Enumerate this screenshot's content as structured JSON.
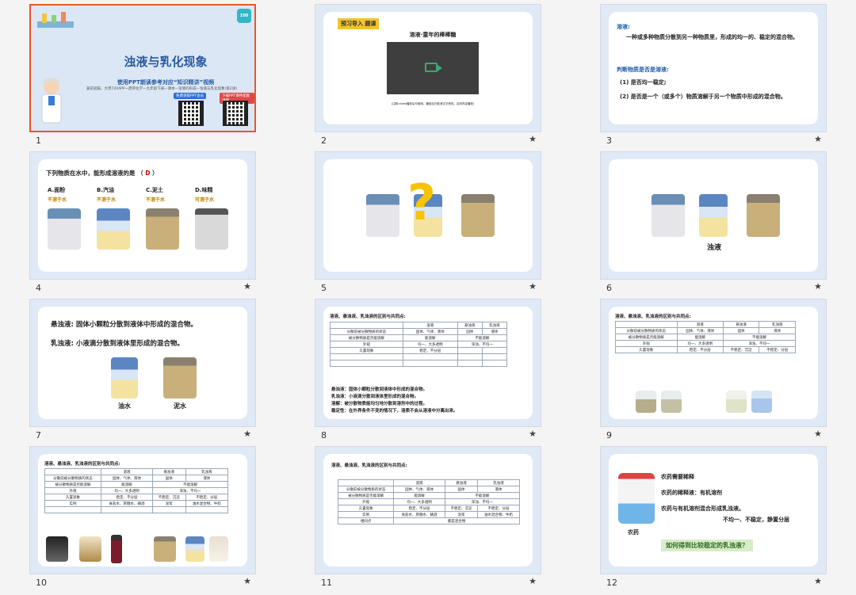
{
  "slides": [
    {
      "num": "1",
      "title": "浊液与乳化现象",
      "subtitle": "使用PPT朗读参考对应“知识精讲”视频",
      "line": "兼前短篇，大用720APP一鼎带化学—九年级下册—课本—溶液的形成—浊液与乳化现象(第2讲)",
      "btn_a": "免费领取PPT会员",
      "btn_b": "下载PPT课件配套讲解",
      "logo": "100"
    },
    {
      "num": "2",
      "tag": "预习导入 题课",
      "video_title": "溶液·童年的棒棒糖",
      "caption": "(注释:video播放后可使用，播放后已取消交叉修改。否则内容播放)"
    },
    {
      "num": "3",
      "h1": "溶液:",
      "def": "一种或多种物质分散到另一种物质里，形成的均一的、稳定的混合物。",
      "h2": "判断物质是否是溶液:",
      "p1": "(1)  是否均一稳定;",
      "p2": "(2)  是否是一个（或多个）物质溶解于另一个物质中形成的混合物。"
    },
    {
      "num": "4",
      "question": "下列物质在水中，能形成溶液的是 （",
      "answer": "D",
      "close": "）",
      "options": [
        {
          "label": "A.面粉",
          "note": "不溶于水"
        },
        {
          "label": "B.汽油",
          "note": "不溶于水"
        },
        {
          "label": "C.泥土",
          "note": "不溶于水"
        },
        {
          "label": "D.味精",
          "note": "可溶于水"
        }
      ]
    },
    {
      "num": "5",
      "mark": "?"
    },
    {
      "num": "6",
      "label": "浊液"
    },
    {
      "num": "7",
      "l1": "悬浊液: 固体小颗粒分散到液体中形成的混合物。",
      "l2": "乳浊液: 小液滴分散到液体里形成的混合物。",
      "c1": "油水",
      "c2": "泥水"
    },
    {
      "num": "8",
      "title": "溶液、悬浊液、乳浊液的区别与共同点:",
      "header": [
        "",
        "溶液",
        "悬浊液",
        "乳浊液"
      ],
      "rows": [
        [
          "分散前被分散物质的状态",
          "固体、气体、液体",
          "固体",
          "液体"
        ],
        [
          "被分散物质是否能溶解",
          "能溶解",
          "不能溶解",
          ""
        ],
        [
          "外观",
          "均一、大多透明",
          "浑浊、不均一",
          ""
        ],
        [
          "久置现象",
          "稳定、不分层",
          "",
          ""
        ],
        [
          "",
          "",
          "",
          ""
        ],
        [
          "",
          "",
          "",
          ""
        ]
      ],
      "notes": [
        "悬浊液：固体小颗粒分散到液体中形成的混合物。",
        "乳浊液：小液滴分散到液体里形成的混合物。",
        "溶解：被分散物质能均匀地分散到溶剂中的过程。",
        "稳定性：在外界条件不变的情况下，溶质不会从溶液中分离出来。"
      ]
    },
    {
      "num": "9",
      "title": "溶液、悬浊液、乳浊液的区别与共同点:",
      "header": [
        "",
        "溶液",
        "悬浊液",
        "乳浊液"
      ],
      "rows": [
        [
          "分散前被分散物质的状态",
          "固体、气体、液体",
          "固体",
          "液体"
        ],
        [
          "被分散物质是否能溶解",
          "能溶解",
          "不能溶解",
          ""
        ],
        [
          "外观",
          "均一、大多透明",
          "浑浊、不均一",
          ""
        ],
        [
          "久置现象",
          "稳定、不分层",
          "不稳定、沉淀",
          "不稳定、分层"
        ]
      ]
    },
    {
      "num": "10",
      "title": "溶液、悬浊液、乳浊液的区别与共同点:",
      "header": [
        "",
        "溶液",
        "悬浊液",
        "乳浊液"
      ],
      "rows": [
        [
          "分散前被分散物质的状态",
          "固体、气体、液体",
          "固体",
          "液体"
        ],
        [
          "被分散物质是否能溶解",
          "能溶解",
          "不能溶解",
          ""
        ],
        [
          "外观",
          "均一、大多透明",
          "浑浊、不均一",
          ""
        ],
        [
          "久置现象",
          "稳定、不分层",
          "不稳定、沉淀",
          "不稳定、分层"
        ],
        [
          "实例",
          "食盐水、蔗糖水、碘酒",
          "泥浆",
          "油水混合物、牛奶"
        ],
        [
          "",
          "",
          "",
          ""
        ]
      ]
    },
    {
      "num": "11",
      "title": "溶液、悬浊液、乳浊液的区别与共同点:",
      "header": [
        "",
        "溶液",
        "悬浊液",
        "乳浊液"
      ],
      "rows": [
        [
          "分散前被分散物质的状态",
          "固体、气体、液体",
          "固体",
          "液体"
        ],
        [
          "被分散物质是否能溶解",
          "能溶解",
          "不能溶解",
          ""
        ],
        [
          "外观",
          "均一、大多透明",
          "浑浊、不均一",
          ""
        ],
        [
          "久置现象",
          "稳定、不分层",
          "不稳定、沉淀",
          "不稳定、分层"
        ],
        [
          "实例",
          "食盐水、蔗糖水、碘酒",
          "泥浆",
          "油水混合物、牛奶"
        ],
        [
          "相同点",
          "都是混合物",
          "",
          ""
        ]
      ]
    },
    {
      "num": "12",
      "l1": "农药需要稀释",
      "l2": "农药的稀释液：有机溶剂",
      "l3": "农药与有机溶剂混合形成乳浊液。",
      "l4": "不均一、不稳定，静置分层",
      "caption": "农药",
      "question": "如何得到比较稳定的乳浊液？"
    }
  ],
  "star": "★"
}
